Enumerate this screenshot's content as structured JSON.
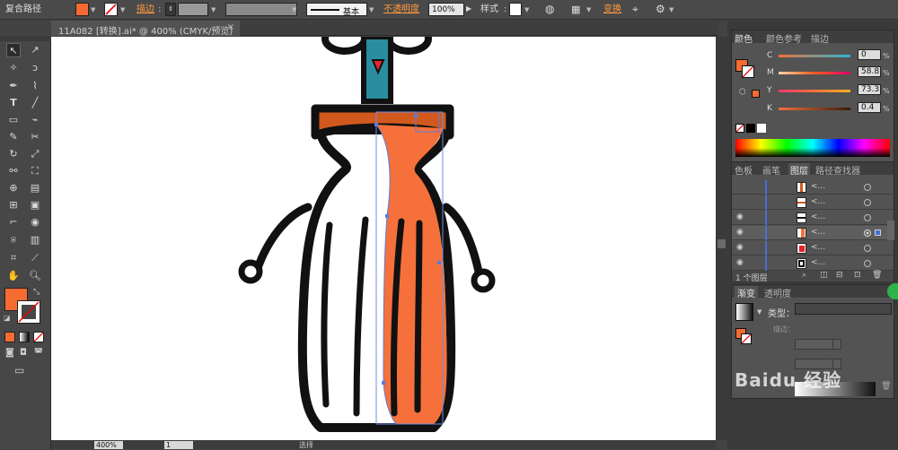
{
  "control_bar": {
    "object_type": "复合路径",
    "stroke_label": "描边",
    "stroke_style": "基本",
    "opacity_label": "不透明度",
    "opacity_value": "100%",
    "style_label": "样式",
    "transform_label": "变换"
  },
  "document_tab": {
    "title": "11A082 [转换].ai* @ 400% (CMYK/预览)",
    "close": "×"
  },
  "color_panel": {
    "tabs": [
      "颜色",
      "颜色参考",
      "描边"
    ],
    "channels": [
      {
        "label": "C",
        "value": "0",
        "unit": "%"
      },
      {
        "label": "M",
        "value": "58.8",
        "unit": "%"
      },
      {
        "label": "Y",
        "value": "73.3",
        "unit": "%"
      },
      {
        "label": "K",
        "value": "0.4",
        "unit": "%"
      }
    ]
  },
  "layers_panel": {
    "tabs": [
      "色板",
      "画笔",
      "图层",
      "路径查找器"
    ],
    "rows": [
      {
        "name": "<..."
      },
      {
        "name": "<..."
      },
      {
        "name": "<..."
      },
      {
        "name": "<..."
      },
      {
        "name": "<..."
      },
      {
        "name": "<..."
      }
    ],
    "footer": "1 个图层"
  },
  "gradient_panel": {
    "tabs": [
      "渐变",
      "透明度"
    ],
    "type_label": "类型：",
    "stroke_label": "描边："
  },
  "status_bar": {
    "zoom": "400%",
    "page": "1",
    "tool": "选择"
  },
  "watermark": "Baidu 经验",
  "colors": {
    "fill": "#f56b32",
    "accent_orange": "#ff9a3c",
    "panel_bg": "#535353"
  }
}
